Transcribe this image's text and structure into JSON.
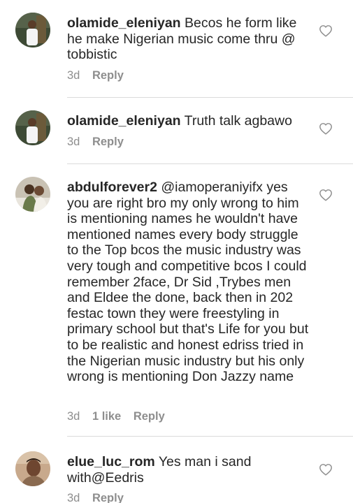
{
  "comments": [
    {
      "username": "olamide_eleniyan",
      "text": "Becos he form like he make Nigerian music come thru @ tobbistic",
      "time": "3d",
      "likes": "",
      "reply_label": "Reply"
    },
    {
      "username": "olamide_eleniyan",
      "text": "Truth talk agbawo",
      "time": "3d",
      "likes": "",
      "reply_label": "Reply"
    },
    {
      "username": "abdulforever2",
      "text": "@iamoperaniyifx yes you are right bro my only wrong to him is mentioning names he wouldn't have mentioned names every body struggle to the Top bcos the music industry was very tough and competitive bcos I could remember 2face, Dr Sid ,Trybes men and Eldee the done, back then in 202 festac town they were freestyling in primary school but that's Life for you but to be realistic and honest edriss tried in the Nigerian music industry but his only wrong is mentioning Don Jazzy name",
      "time": "3d",
      "likes": "1 like",
      "reply_label": "Reply"
    },
    {
      "username": "elue_luc_rom",
      "text": "Yes man i sand with@Eedris",
      "time": "3d",
      "likes": "",
      "reply_label": "Reply"
    }
  ],
  "colors": {
    "text": "#262626",
    "meta": "#8e8e8e",
    "divider": "#dbdbdb"
  },
  "icons": {
    "like": "heart-outline-icon"
  }
}
